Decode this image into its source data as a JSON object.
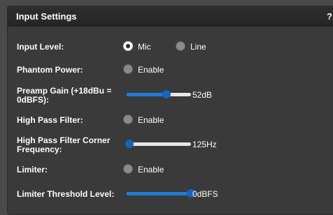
{
  "panel": {
    "title": "Input Settings",
    "help": "?"
  },
  "input_level": {
    "label": "Input Level:",
    "options": [
      {
        "label": "Mic",
        "checked": true
      },
      {
        "label": "Line",
        "checked": false
      }
    ]
  },
  "phantom_power": {
    "label": "Phantom Power:",
    "option_label": "Enable",
    "checked": false
  },
  "preamp_gain": {
    "label": "Preamp Gain (+18dBu = 0dBFS):",
    "value": "52dB",
    "level_fraction": 0.62
  },
  "high_pass_filter": {
    "label": "High Pass Filter:",
    "option_label": "Enable",
    "checked": false
  },
  "hpf_corner": {
    "label": "High Pass Filter Corner Frequency:",
    "value": "125Hz",
    "level_fraction": 0.04
  },
  "limiter": {
    "label": "Limiter:",
    "option_label": "Enable",
    "checked": false
  },
  "limiter_threshold": {
    "label": "Limiter Threshold Level:",
    "value": "0dBFS",
    "level_fraction": 1.0
  },
  "colors": {
    "background": "#4a4a4a",
    "panel": "#3a3a3a",
    "accent": "#1e7bd6",
    "text": "#ffffff"
  }
}
